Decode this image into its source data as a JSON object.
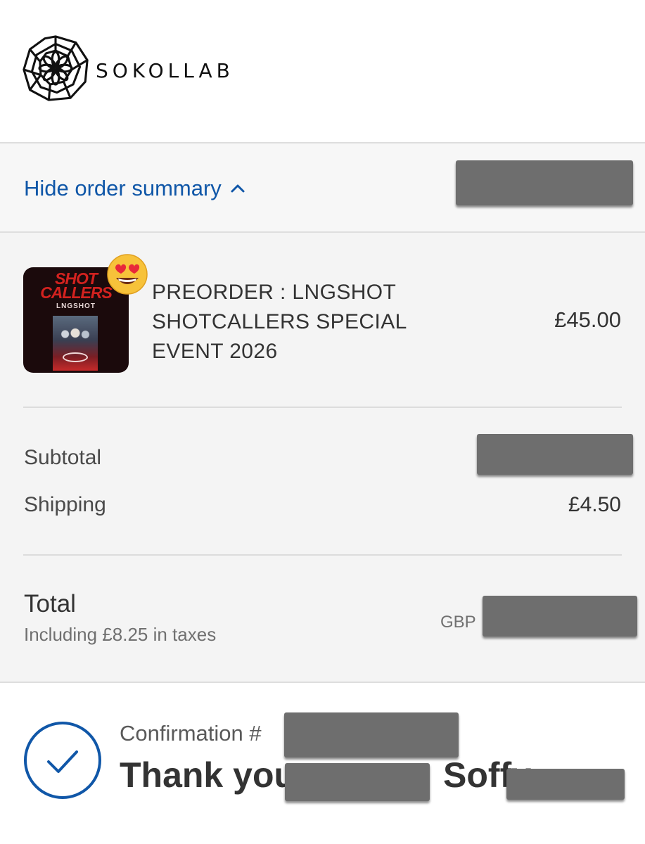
{
  "brand": {
    "name": "SOKOLLAB",
    "logo_icon": "geometric-mandala-icon"
  },
  "order_summary_toggle": {
    "label": "Hide order summary",
    "icon": "chevron-up-icon"
  },
  "line_items": [
    {
      "thumbnail_title": "SHOT CALLERS",
      "thumbnail_subtitle": "LNGSHOT",
      "badge_icon": "heart-eyes-emoji-icon",
      "name": "PREORDER : LNGSHOT SHOTCALLERS SPECIAL EVENT 2026",
      "price": "£45.00"
    }
  ],
  "costs": {
    "subtotal_label": "Subtotal",
    "shipping_label": "Shipping",
    "shipping_value": "£4.50"
  },
  "total": {
    "label": "Total",
    "tax_note": "Including £8.25 in taxes",
    "currency": "GBP"
  },
  "confirmation": {
    "number_label": "Confirmation #",
    "thank_you_prefix": "Thank you",
    "name_fragment": "Soffy",
    "status_icon": "check-circle-icon"
  },
  "colors": {
    "link": "#1057a8",
    "check": "#1057a8",
    "redaction": "#6e6e6e"
  }
}
